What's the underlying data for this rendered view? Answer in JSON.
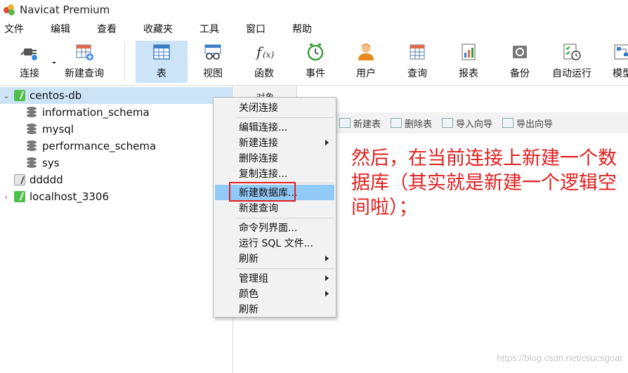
{
  "window": {
    "title": "Navicat Premium"
  },
  "menubar": [
    "文件",
    "编辑",
    "查看",
    "收藏夹",
    "工具",
    "窗口",
    "帮助"
  ],
  "toolbar": [
    {
      "label": "连接",
      "icon": "plug-connection-icon"
    },
    {
      "label": "新建查询",
      "icon": "new-query-grid-icon"
    },
    {
      "label": "表",
      "icon": "table-grid-icon",
      "active": true
    },
    {
      "label": "视图",
      "icon": "view-glasses-icon"
    },
    {
      "label": "函数",
      "icon": "function-fx-icon"
    },
    {
      "label": "事件",
      "icon": "clock-event-icon"
    },
    {
      "label": "用户",
      "icon": "user-person-icon"
    },
    {
      "label": "查询",
      "icon": "query-grid-icon"
    },
    {
      "label": "报表",
      "icon": "report-document-icon"
    },
    {
      "label": "备份",
      "icon": "backup-drive-icon"
    },
    {
      "label": "自动运行",
      "icon": "checklist-clock-icon"
    },
    {
      "label": "模型",
      "icon": "model-diagram-icon"
    }
  ],
  "tree": [
    {
      "label": "centos-db",
      "type": "connection",
      "state": "expanded",
      "selected": true
    },
    {
      "label": "information_schema",
      "type": "database"
    },
    {
      "label": "mysql",
      "type": "database"
    },
    {
      "label": "performance_schema",
      "type": "database"
    },
    {
      "label": "sys",
      "type": "database"
    },
    {
      "label": "ddddd",
      "type": "connection",
      "state": "closed"
    },
    {
      "label": "localhost_3306",
      "type": "connection",
      "state": "collapsed"
    }
  ],
  "objects_tab": "对象",
  "object_toolbar": [
    "新建表",
    "删除表",
    "导入向导",
    "导出向导"
  ],
  "context_menu": [
    {
      "label": "关闭连接"
    },
    {
      "label": "编辑连接..."
    },
    {
      "label": "新建连接",
      "submenu": true
    },
    {
      "label": "删除连接"
    },
    {
      "label": "复制连接..."
    },
    {
      "label": "新建数据库...",
      "highlighted": true
    },
    {
      "label": "新建查询"
    },
    {
      "label": "命令列界面..."
    },
    {
      "label": "运行 SQL 文件..."
    },
    {
      "label": "刷新",
      "submenu": true
    },
    {
      "label": "管理组",
      "submenu": true
    },
    {
      "label": "颜色",
      "submenu": true
    },
    {
      "label": "刷新"
    }
  ],
  "annotation": "然后，在当前连接上新建一个数据库（其实就是新建一个逻辑空间啦）；",
  "watermark": "https://blog.csdn.net/csucsgoat",
  "colors": {
    "accent": "#cde4f7",
    "menu_highlight": "#91c9f7",
    "annotation": "#e02020",
    "connection_active": "#4dbf4a"
  }
}
